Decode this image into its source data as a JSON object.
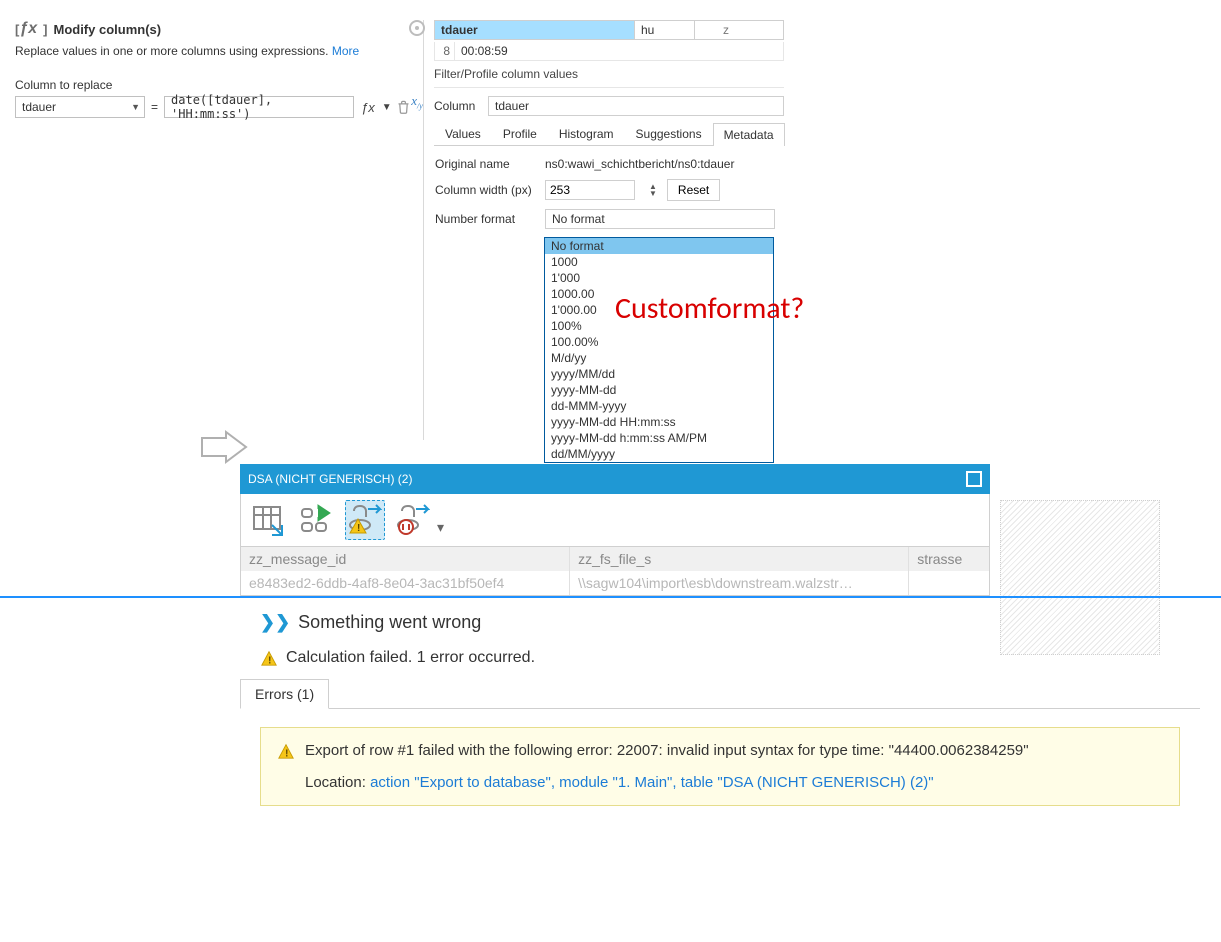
{
  "left": {
    "title": "Modify column(s)",
    "desc": "Replace values in one or more columns using expressions.",
    "more": "More",
    "column_to_replace_label": "Column to replace",
    "column_value": "tdauer",
    "expr": "date([tdauer], 'HH:mm:ss')"
  },
  "right": {
    "header_cells": {
      "c1": "tdauer",
      "c2": "hu",
      "c3": "z"
    },
    "row_idx": "8",
    "row_val": "00:08:59",
    "filter_label": "Filter/Profile column values",
    "column_label": "Column",
    "column_value": "tdauer",
    "tabs": [
      "Values",
      "Profile",
      "Histogram",
      "Suggestions",
      "Metadata"
    ],
    "original_name_label": "Original name",
    "original_name_value": "ns0:wawi_schichtbericht/ns0:tdauer",
    "col_width_label": "Column width (px)",
    "col_width_value": "253",
    "reset_label": "Reset",
    "num_format_label": "Number format",
    "num_format_value": "No format",
    "format_options": [
      "No format",
      "1000",
      "1'000",
      "1000.00",
      "1'000.00",
      "100%",
      "100.00%",
      "M/d/yy",
      "yyyy/MM/dd",
      "yyyy-MM-dd",
      "dd-MMM-yyyy",
      "yyyy-MM-dd HH:mm:ss",
      "yyyy-MM-dd h:mm:ss AM/PM",
      "dd/MM/yyyy"
    ]
  },
  "annotation": "Customformat?",
  "bottom": {
    "window_title": "DSA (NICHT GENERISCH) (2)",
    "cols": {
      "c1": "zz_message_id",
      "c2": "zz_fs_file_s",
      "c3": "strasse"
    },
    "row": {
      "c1": "e8483ed2-6ddb-4af8-8e04-3ac31bf50ef4",
      "c2": "\\\\sagw104\\import\\esb\\downstream.walzstr…",
      "c3": ""
    },
    "something_wrong": "Something went wrong",
    "calc_failed": "Calculation failed. 1 error occurred.",
    "errors_tab": "Errors (1)",
    "error_text": "Export of row #1 failed with the following error: 22007: invalid input syntax for type time: \"44400.0062384259\"",
    "location_label": "Location:",
    "location_link": "action \"Export to database\", module \"1. Main\", table \"DSA (NICHT GENERISCH) (2)\""
  }
}
